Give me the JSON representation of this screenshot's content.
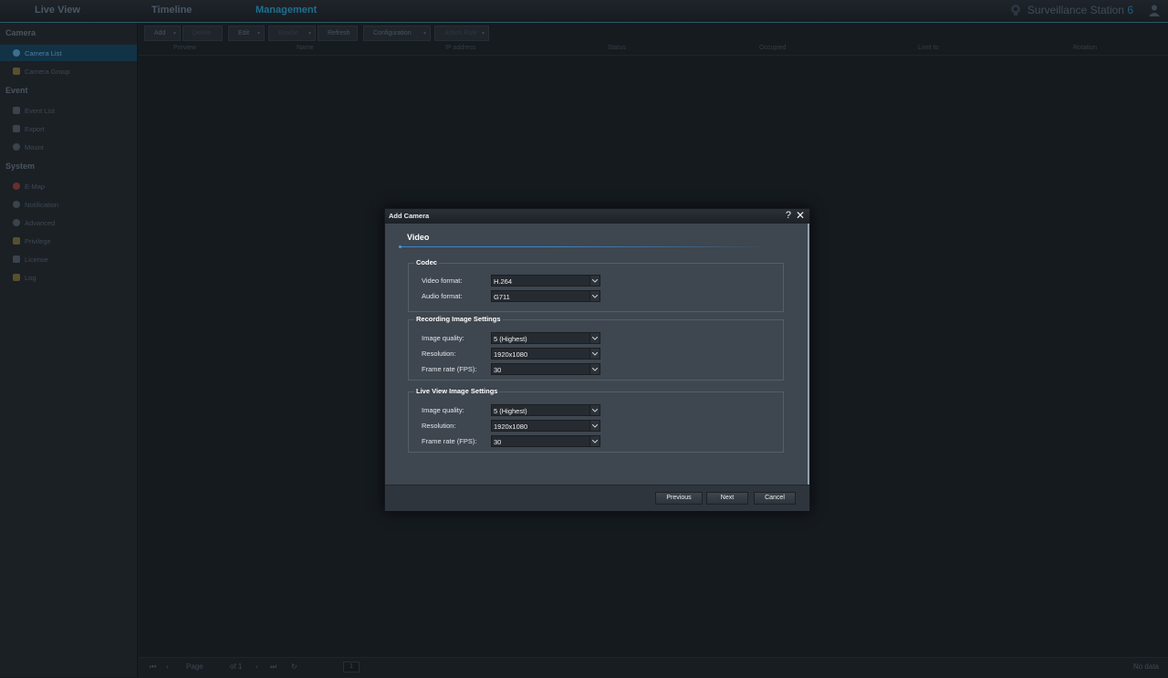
{
  "topnav": {
    "tabs": [
      {
        "label": "Live View"
      },
      {
        "label": "Timeline"
      },
      {
        "label": "Management"
      }
    ],
    "brand": "Surveillance Station",
    "brand_version": "6"
  },
  "sidebar": {
    "sections": [
      {
        "title": "Camera",
        "items": [
          {
            "label": "Camera List"
          },
          {
            "label": "Camera Group"
          }
        ]
      },
      {
        "title": "Event",
        "items": [
          {
            "label": "Event List"
          },
          {
            "label": "Export"
          },
          {
            "label": "Mount"
          }
        ]
      },
      {
        "title": "System",
        "items": [
          {
            "label": "E-Map"
          },
          {
            "label": "Notification"
          },
          {
            "label": "Advanced"
          },
          {
            "label": "Privilege"
          },
          {
            "label": "License"
          },
          {
            "label": "Log"
          }
        ]
      }
    ]
  },
  "toolbar": {
    "buttons": [
      {
        "label": "Add"
      },
      {
        "label": "Delete"
      },
      {
        "label": "Edit"
      },
      {
        "label": "Enable"
      },
      {
        "label": "Refresh"
      },
      {
        "label": "Configuration"
      },
      {
        "label": "Action Rule"
      }
    ]
  },
  "grid": {
    "columns": [
      "Preview",
      "Name",
      "IP address",
      "Status",
      "Occupied",
      "Limit to",
      "Rotation"
    ]
  },
  "pager": {
    "page_label": "Page",
    "page_value": "1",
    "of_label": "of 1",
    "status": "No data"
  },
  "dialog": {
    "title": "Add Camera",
    "step_title": "Video",
    "groups": [
      {
        "legend": "Codec",
        "fields": [
          {
            "label": "Video format:",
            "value": "H.264"
          },
          {
            "label": "Audio format:",
            "value": "G711"
          }
        ]
      },
      {
        "legend": "Recording Image Settings",
        "fields": [
          {
            "label": "Image quality:",
            "value": "5 (Highest)"
          },
          {
            "label": "Resolution:",
            "value": "1920x1080"
          },
          {
            "label": "Frame rate (FPS):",
            "value": "30"
          }
        ]
      },
      {
        "legend": "Live View Image Settings",
        "fields": [
          {
            "label": "Image quality:",
            "value": "5 (Highest)"
          },
          {
            "label": "Resolution:",
            "value": "1920x1080"
          },
          {
            "label": "Frame rate (FPS):",
            "value": "30"
          }
        ]
      }
    ],
    "buttons": {
      "previous": "Previous",
      "next": "Next",
      "cancel": "Cancel"
    }
  }
}
